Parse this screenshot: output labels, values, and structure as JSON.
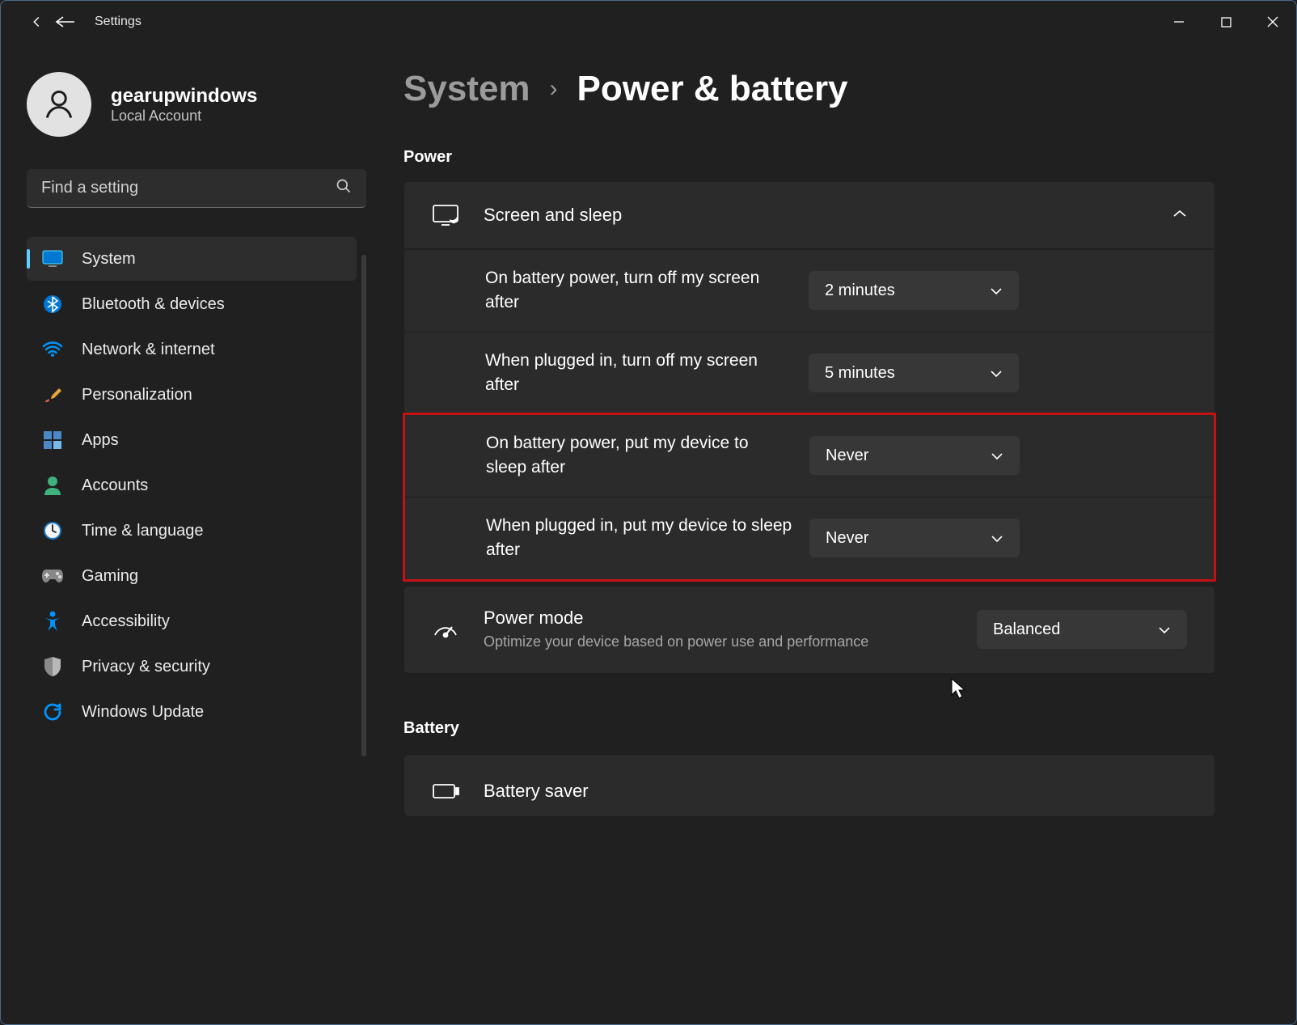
{
  "window": {
    "app_title": "Settings"
  },
  "user": {
    "name": "gearupwindows",
    "subtitle": "Local Account"
  },
  "search": {
    "placeholder": "Find a setting"
  },
  "nav": {
    "items": [
      {
        "label": "System",
        "icon": "monitor"
      },
      {
        "label": "Bluetooth & devices",
        "icon": "bluetooth"
      },
      {
        "label": "Network & internet",
        "icon": "wifi"
      },
      {
        "label": "Personalization",
        "icon": "brush"
      },
      {
        "label": "Apps",
        "icon": "apps"
      },
      {
        "label": "Accounts",
        "icon": "person"
      },
      {
        "label": "Time & language",
        "icon": "clock"
      },
      {
        "label": "Gaming",
        "icon": "gamepad"
      },
      {
        "label": "Accessibility",
        "icon": "accessibility"
      },
      {
        "label": "Privacy & security",
        "icon": "shield"
      },
      {
        "label": "Windows Update",
        "icon": "update"
      }
    ]
  },
  "breadcrumb": {
    "parent": "System",
    "current": "Power & battery"
  },
  "sections": {
    "power": "Power",
    "battery": "Battery"
  },
  "screen_sleep": {
    "title": "Screen and sleep",
    "rows": [
      {
        "label": "On battery power, turn off my screen after",
        "value": "2 minutes"
      },
      {
        "label": "When plugged in, turn off my screen after",
        "value": "5 minutes"
      },
      {
        "label": "On battery power, put my device to sleep after",
        "value": "Never"
      },
      {
        "label": "When plugged in, put my device to sleep after",
        "value": "Never"
      }
    ]
  },
  "power_mode": {
    "title": "Power mode",
    "subtitle": "Optimize your device based on power use and performance",
    "value": "Balanced"
  },
  "battery_saver": {
    "title": "Battery saver"
  }
}
